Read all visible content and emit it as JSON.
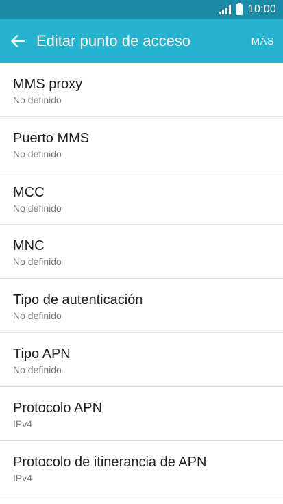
{
  "status_bar": {
    "time": "10:00",
    "signal_icon": "signal-icon",
    "battery_icon": "battery-icon"
  },
  "app_bar": {
    "back_icon": "arrow-back-icon",
    "title": "Editar punto de acceso",
    "more_label": "MÁS"
  },
  "colors": {
    "status_bar": "#1b8ba8",
    "app_bar": "#25b3d1",
    "divider": "#e2e2e2",
    "title_text": "#212121",
    "subtitle_text": "#7a7a7a"
  },
  "settings": [
    {
      "title": "MMS proxy",
      "value": "No definido"
    },
    {
      "title": "Puerto MMS",
      "value": "No definido"
    },
    {
      "title": "MCC",
      "value": "No definido"
    },
    {
      "title": "MNC",
      "value": "No definido"
    },
    {
      "title": "Tipo de autenticación",
      "value": "No definido"
    },
    {
      "title": "Tipo APN",
      "value": "No definido"
    },
    {
      "title": "Protocolo APN",
      "value": "IPv4"
    },
    {
      "title": "Protocolo de itinerancia de APN",
      "value": "IPv4"
    }
  ]
}
